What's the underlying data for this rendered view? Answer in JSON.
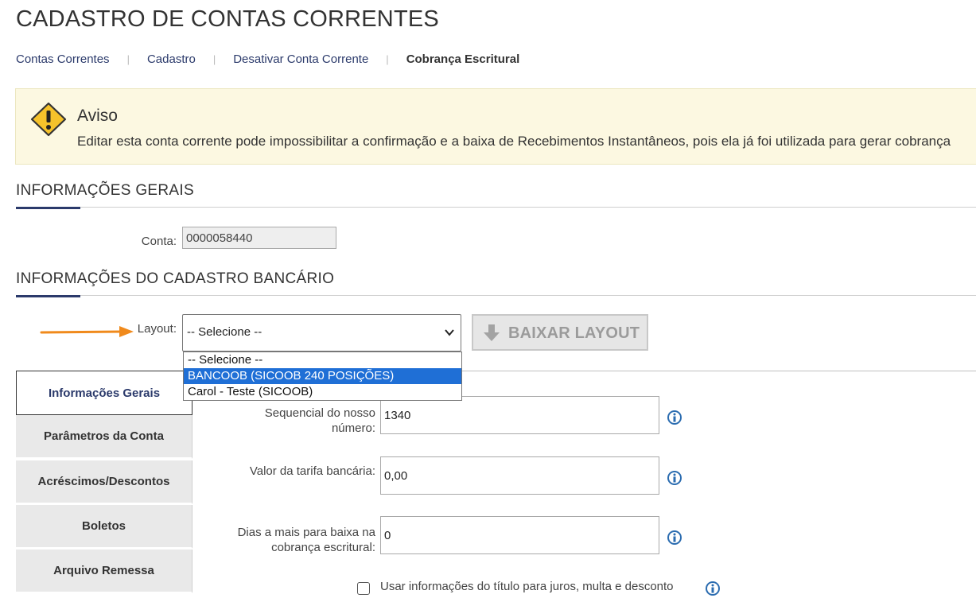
{
  "page": {
    "title": "CADASTRO DE CONTAS CORRENTES"
  },
  "breadcrumb": {
    "items": [
      "Contas Correntes",
      "Cadastro",
      "Desativar Conta Corrente",
      "Cobrança Escritural"
    ],
    "separator": "|"
  },
  "warning": {
    "title": "Aviso",
    "text": "Editar esta conta corrente pode impossibilitar a confirmação e a baixa de Recebimentos Instantâneos, pois ela já foi utilizada para gerar cobrança",
    "icon": "warning-icon"
  },
  "sections": {
    "general": "INFORMAÇÕES GERAIS",
    "bank": "INFORMAÇÕES DO CADASTRO BANCÁRIO"
  },
  "account": {
    "label": "Conta:",
    "value": "0000058440"
  },
  "layout": {
    "label": "Layout:",
    "selected": "-- Selecione --",
    "options": [
      "-- Selecione --",
      "BANCOOB (SICOOB 240 POSIÇÕES)",
      "Carol - Teste (SICOOB)"
    ],
    "highlighted_index": 1,
    "download_button": "BAIXAR LAYOUT"
  },
  "tabs": [
    "Informações Gerais",
    "Parâmetros da Conta",
    "Acréscimos/Descontos",
    "Boletos",
    "Arquivo Remessa"
  ],
  "form": {
    "sequencial_label_line1": "Sequencial do nosso",
    "sequencial_label_line2": "número:",
    "sequencial_value": "1340",
    "tarifa_label": "Valor da tarifa bancária:",
    "tarifa_value": "0,00",
    "dias_label_line1": "Dias a mais para baixa na",
    "dias_label_line2": "cobrança escritural:",
    "dias_value": "0",
    "checkbox_label": "Usar informações do título para juros, multa e desconto"
  },
  "colors": {
    "accent": "#2b3a6b",
    "warning_bg": "#fcf8e1",
    "highlight": "#1f6fd6",
    "arrow": "#f08a1c"
  }
}
